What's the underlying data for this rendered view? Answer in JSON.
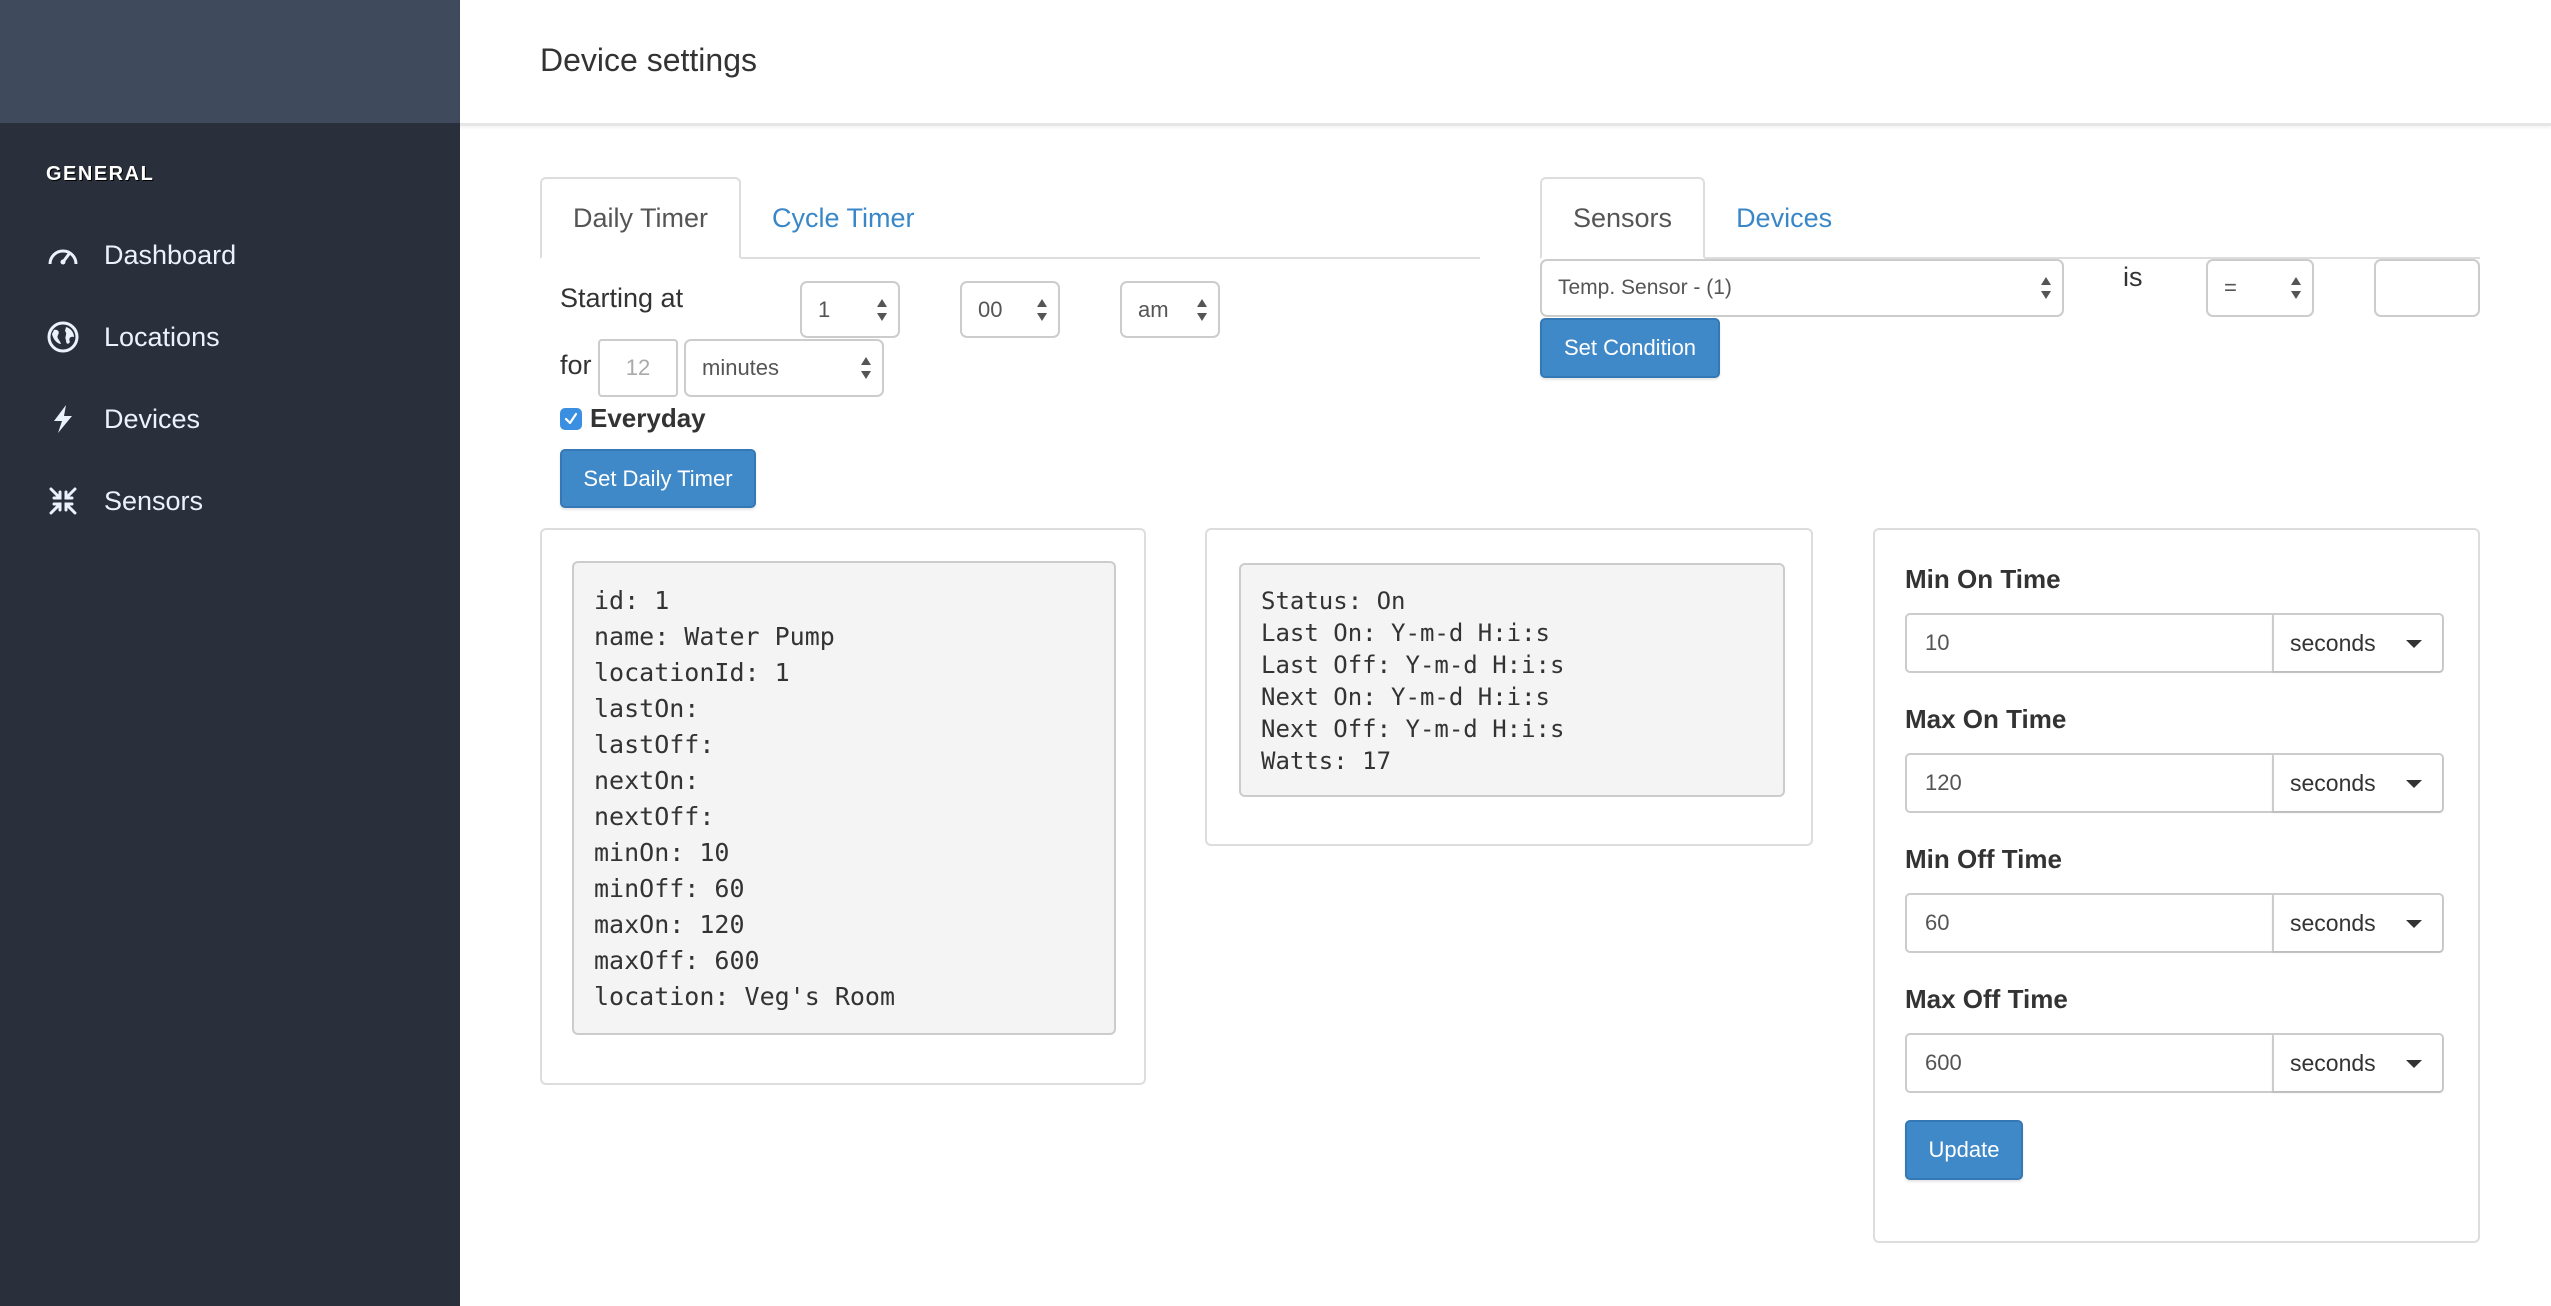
{
  "sidebar": {
    "section_label": "GENERAL",
    "items": [
      {
        "label": "Dashboard",
        "icon": "dashboard-gauge-icon"
      },
      {
        "label": "Locations",
        "icon": "globe-icon"
      },
      {
        "label": "Devices",
        "icon": "lightning-bolt-icon"
      },
      {
        "label": "Sensors",
        "icon": "compress-arrows-icon"
      }
    ]
  },
  "header": {
    "title": "Device settings"
  },
  "timer": {
    "tabs": [
      {
        "label": "Daily Timer",
        "active": true
      },
      {
        "label": "Cycle Timer",
        "active": false
      }
    ],
    "starting_at_label": "Starting at",
    "hour": "1",
    "minute": "00",
    "ampm": "am",
    "for_label": "for",
    "duration_placeholder": "12",
    "duration_unit": "minutes",
    "everyday_label": "Everyday",
    "everyday_checked": true,
    "set_button": "Set Daily Timer"
  },
  "condition": {
    "tabs": [
      {
        "label": "Sensors",
        "active": true
      },
      {
        "label": "Devices",
        "active": false
      }
    ],
    "sensor": "Temp. Sensor - (1)",
    "is_label": "is",
    "operator": "=",
    "value": "",
    "set_button": "Set Condition"
  },
  "device_info": {
    "lines": [
      "id: 1",
      "name: Water Pump",
      "locationId: 1",
      "lastOn:",
      "lastOff:",
      "nextOn:",
      "nextOff:",
      "minOn: 10",
      "minOff: 60",
      "maxOn: 120",
      "maxOff: 600",
      "location: Veg's Room"
    ]
  },
  "device_status": {
    "lines": [
      "Status: On",
      "Last On: Y-m-d H:i:s",
      "Last Off: Y-m-d H:i:s",
      "Next On: Y-m-d H:i:s",
      "Next Off: Y-m-d H:i:s",
      "Watts: 17"
    ]
  },
  "limits": {
    "fields": [
      {
        "label": "Min On Time",
        "value": "10",
        "unit": "seconds"
      },
      {
        "label": "Max On Time",
        "value": "120",
        "unit": "seconds"
      },
      {
        "label": "Min Off Time",
        "value": "60",
        "unit": "seconds"
      },
      {
        "label": "Max Off Time",
        "value": "600",
        "unit": "seconds"
      }
    ],
    "update_button": "Update"
  },
  "colors": {
    "accent": "#4089c9",
    "sidebar": "#29303b",
    "sidebar_brand": "#3f4b5c",
    "link": "#3a87c8"
  }
}
